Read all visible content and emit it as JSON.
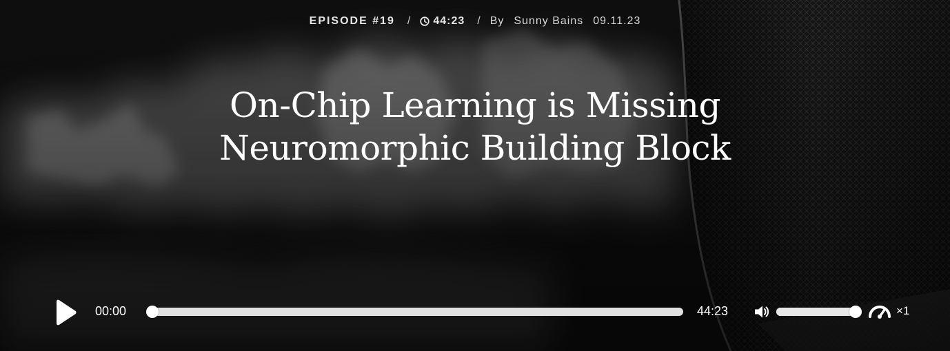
{
  "episode": {
    "label": "EPISODE #19",
    "separator": "/",
    "duration": "44:23",
    "by_label": "By",
    "author": "Sunny Bains",
    "date": "09.11.23"
  },
  "title": {
    "line1": "On-Chip Learning is Missing",
    "line2": "Neuromorphic Building Block"
  },
  "player": {
    "current_time": "00:00",
    "total_time": "44:23",
    "progress": 0,
    "volume": 1,
    "speed": "×1"
  },
  "icons": {
    "clock": "clock-icon",
    "play": "play-icon",
    "volume": "volume-icon",
    "speed": "speedometer-icon"
  },
  "colors": {
    "background": "#0d0d0d",
    "text": "#ffffff",
    "track": "#e1e1e1"
  }
}
